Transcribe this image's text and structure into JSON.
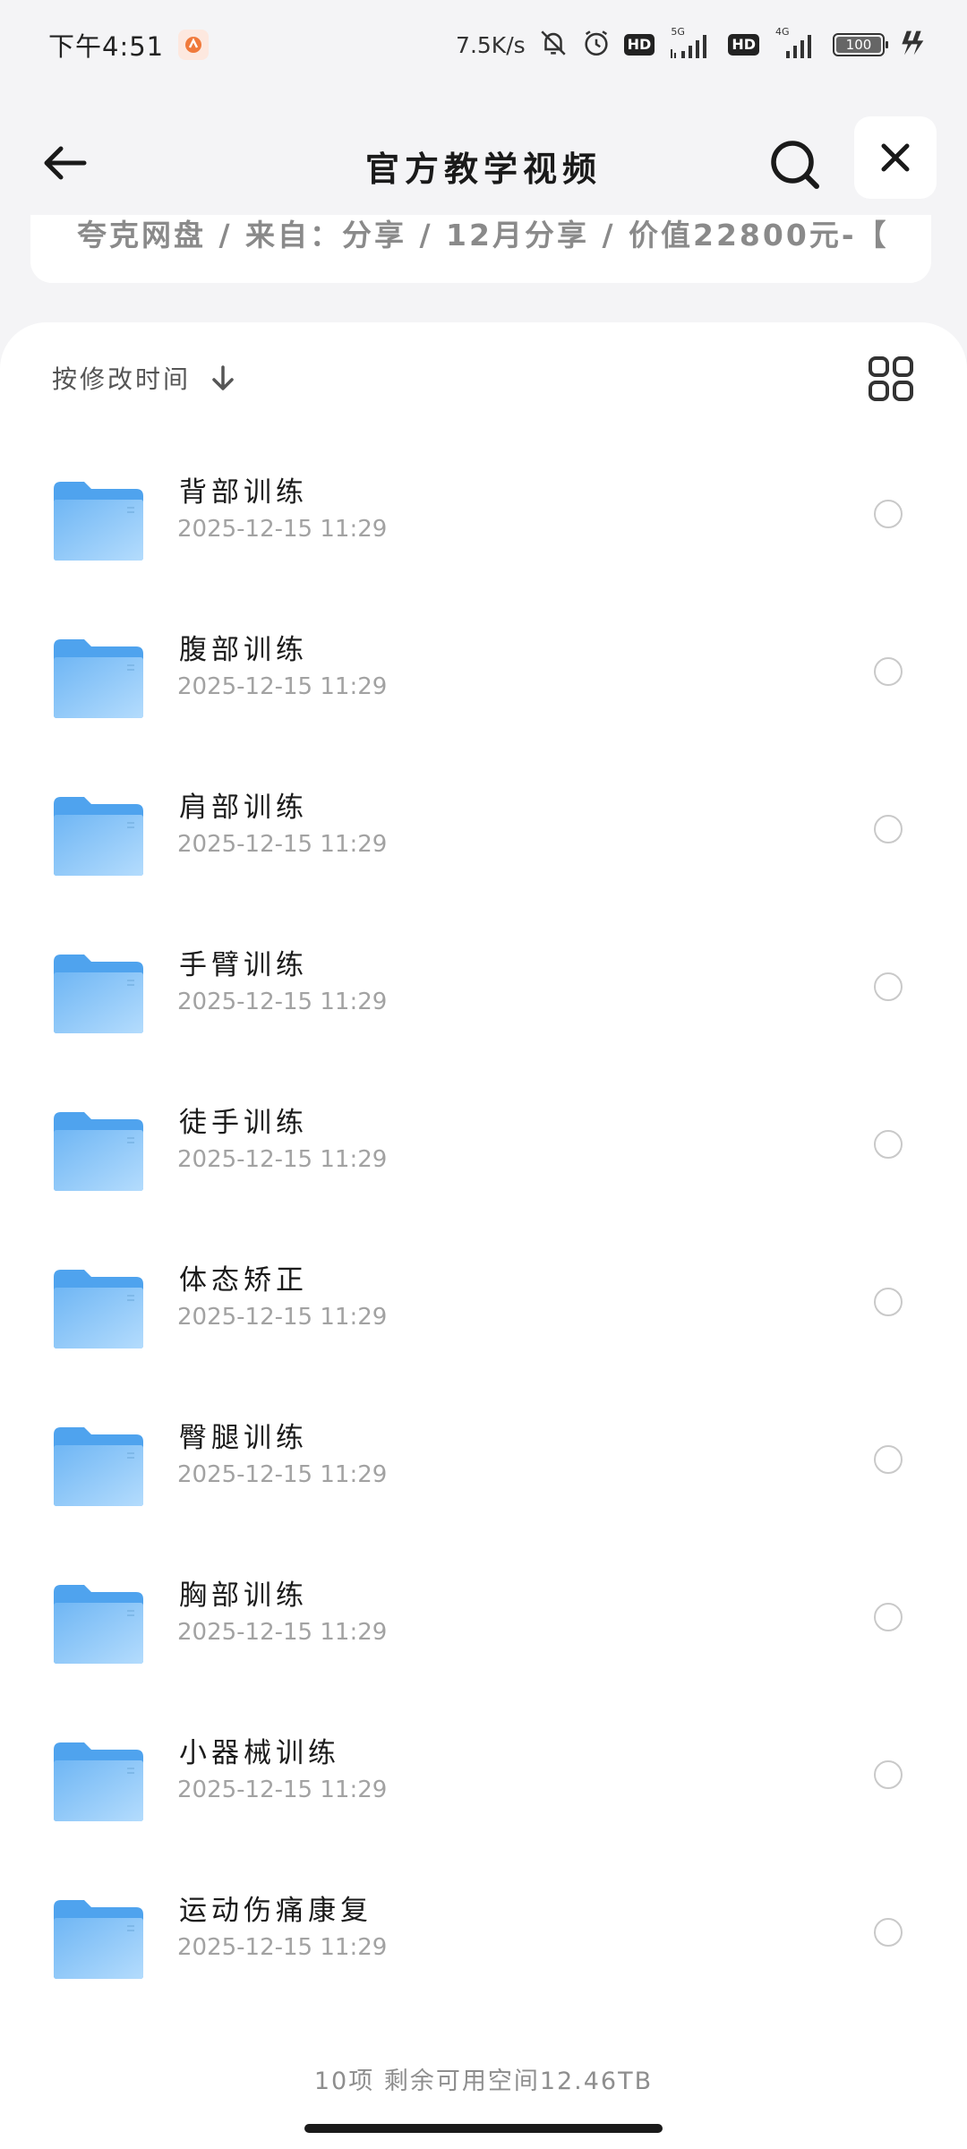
{
  "status_bar": {
    "time": "下午4:51",
    "net_speed": "7.5K/s",
    "hd_badge": "HD",
    "sig1_tag": "5G",
    "sig2_tag": "4G",
    "battery": "100"
  },
  "header": {
    "title": "官方教学视频",
    "path": "夸克网盘 / 来自：分享 / 12月分享 / 价值22800元-【"
  },
  "toolbar": {
    "sort_label": "按修改时间"
  },
  "files": [
    {
      "name": "背部训练",
      "date": "2025-12-15  11:29"
    },
    {
      "name": "腹部训练",
      "date": "2025-12-15  11:29"
    },
    {
      "name": "肩部训练",
      "date": "2025-12-15  11:29"
    },
    {
      "name": "手臂训练",
      "date": "2025-12-15  11:29"
    },
    {
      "name": "徒手训练",
      "date": "2025-12-15  11:29"
    },
    {
      "name": "体态矫正",
      "date": "2025-12-15  11:29"
    },
    {
      "name": "臀腿训练",
      "date": "2025-12-15  11:29"
    },
    {
      "name": "胸部训练",
      "date": "2025-12-15  11:29"
    },
    {
      "name": "小器械训练",
      "date": "2025-12-15  11:29"
    },
    {
      "name": "运动伤痛康复",
      "date": "2025-12-15  11:29"
    }
  ],
  "footer": {
    "summary": "10项  剩余可用空间12.46TB"
  },
  "icons": {
    "back": "arrow-left-icon",
    "search": "search-icon",
    "close": "close-icon",
    "sort": "arrow-down-icon",
    "view": "grid-view-icon",
    "folder": "folder-icon"
  },
  "colors": {
    "folder_top": "#4fa3ee",
    "folder_body": "#9fd0fb",
    "accent_text": "#1b1b1b"
  }
}
